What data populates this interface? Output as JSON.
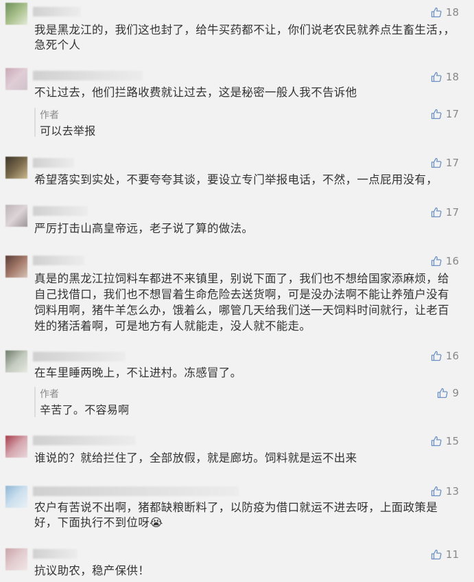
{
  "author_label": "作者",
  "comments": [
    {
      "likes": "18",
      "text": "我是黑龙江的，我们这也封了，给牛买药都不让，你们说老农民就养点生畜生活，，急死个人"
    },
    {
      "likes": "18",
      "text": "不让过去，他们拦路收费就让过去，这是秘密一般人我不告诉他",
      "reply": {
        "likes": "17",
        "text": "可以去举报"
      }
    },
    {
      "likes": "17",
      "text": "希望落实到实处，不要夸夸其谈，要设立专门举报电话，不然，一点屁用没有，"
    },
    {
      "likes": "17",
      "text": "严厉打击山高皇帝远，老子说了算的做法。"
    },
    {
      "likes": "16",
      "text": "真是的黑龙江拉饲料车都进不来镇里，别说下面了，我们也不想给国家添麻烦，给自己找借口，我们也不想冒着生命危险去送货啊，可是没办法啊不能让养殖户没有饲料用啊，猪牛羊怎么办，饿着么，哪管几天给我们送一天饲料时间就行，让老百姓的猪活着啊，可是地方有人就能走，没人就不能走。"
    },
    {
      "likes": "16",
      "text": "在车里睡两晚上，不让进村。冻感冒了。",
      "reply": {
        "likes": "9",
        "text": "辛苦了。不容易啊"
      }
    },
    {
      "likes": "15",
      "text": "谁说的？就给拦住了，全部放假，就是廊坊。饲料就是运不出来"
    },
    {
      "likes": "13",
      "text": "农户有苦说不出啊，猪都缺粮断料了，以防疫为借口就运不进去呀，上面政策是好，下面执行不到位呀😭"
    },
    {
      "likes": "11",
      "text": "抗议助农，稳产保供！"
    }
  ]
}
